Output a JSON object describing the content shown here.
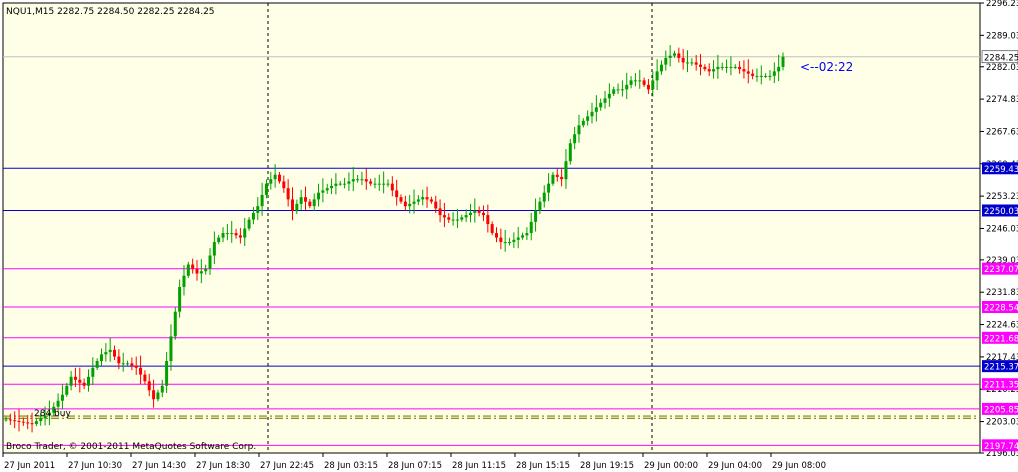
{
  "window": {
    "symbol_label": "NQU1,M15  2282.75 2284.50 2282.25 2284.25",
    "copyright": "Broco Trader, © 2001-2011 MetaQuotes Software Corp.",
    "timer_label": "<--02:22",
    "level_tag": "284 buy"
  },
  "colors": {
    "background": "#ffffe8",
    "bull_candle": "#00a000",
    "bear_candle": "#ff0000",
    "blue_level": "#0000cc",
    "magenta_level": "#ff00ff",
    "dash_dot_level": "#808000",
    "separator": "#000000",
    "grid_price_line": "#c0c0c0",
    "timer_text": "#0000ff"
  },
  "chart_data": {
    "type": "candlestick",
    "ylim": [
      2196.03,
      2296.23
    ],
    "y_ticks": [
      "2296.23",
      "2289.03",
      "2282.03",
      "2274.83",
      "2267.63",
      "2260.43",
      "2253.23",
      "2246.03",
      "2239.03",
      "2231.83",
      "2224.63",
      "2217.43",
      "2210.23",
      "2203.03",
      "2196.03"
    ],
    "x_ticks": [
      "27 Jun 2011",
      "27 Jun 10:30",
      "27 Jun 14:30",
      "27 Jun 18:30",
      "27 Jun 22:45",
      "28 Jun 03:15",
      "28 Jun 07:15",
      "28 Jun 11:15",
      "28 Jun 15:15",
      "28 Jun 19:15",
      "29 Jun 00:00",
      "29 Jun 04:00",
      "29 Jun 08:00"
    ],
    "day_separators": [
      "27 Jun 22:45",
      "29 Jun 00:00"
    ],
    "current_price": {
      "value": 2284.25,
      "label": "2284.25"
    },
    "levels": [
      {
        "value": 2259.43,
        "label": "2259.43",
        "color": "blue"
      },
      {
        "value": 2250.03,
        "label": "2250.03",
        "color": "blue"
      },
      {
        "value": 2237.07,
        "label": "2237.07",
        "color": "magenta"
      },
      {
        "value": 2228.54,
        "label": "2228.54",
        "color": "magenta"
      },
      {
        "value": 2221.68,
        "label": "2221.68",
        "color": "magenta"
      },
      {
        "value": 2215.37,
        "label": "2215.37",
        "color": "blue"
      },
      {
        "value": 2211.35,
        "label": "2211.35",
        "color": "magenta"
      },
      {
        "value": 2205.85,
        "label": "2205.85",
        "color": "magenta"
      },
      {
        "value": 2197.74,
        "label": "2197.74",
        "color": "magenta"
      }
    ],
    "dash_dot_levels": [
      2203.75,
      2204.25
    ],
    "price_path": [
      [
        0,
        2203.5
      ],
      [
        6,
        2202.5
      ],
      [
        10,
        2205
      ],
      [
        13,
        2209
      ],
      [
        15,
        2213
      ],
      [
        18,
        2211
      ],
      [
        20,
        2215
      ],
      [
        22,
        2218
      ],
      [
        24,
        2219
      ],
      [
        26,
        2216
      ],
      [
        28,
        2216
      ],
      [
        30,
        2215
      ],
      [
        32,
        2212
      ],
      [
        34,
        2208
      ],
      [
        36,
        2211
      ],
      [
        38,
        2222
      ],
      [
        40,
        2233
      ],
      [
        42,
        2238
      ],
      [
        44,
        2236
      ],
      [
        46,
        2237
      ],
      [
        48,
        2243
      ],
      [
        50,
        2245
      ],
      [
        52,
        2245
      ],
      [
        54,
        2244
      ],
      [
        56,
        2248
      ],
      [
        58,
        2251
      ],
      [
        60,
        2256
      ],
      [
        62,
        2258
      ],
      [
        64,
        2255
      ],
      [
        66,
        2250
      ],
      [
        68,
        2253
      ],
      [
        70,
        2251
      ],
      [
        72,
        2254
      ],
      [
        74,
        2255
      ],
      [
        76,
        2256
      ],
      [
        78,
        2256
      ],
      [
        80,
        2257
      ],
      [
        82,
        2257
      ],
      [
        84,
        2256
      ],
      [
        86,
        2256
      ],
      [
        88,
        2256
      ],
      [
        90,
        2253
      ],
      [
        92,
        2251
      ],
      [
        94,
        2252
      ],
      [
        96,
        2253
      ],
      [
        98,
        2252
      ],
      [
        100,
        2249
      ],
      [
        102,
        2248
      ],
      [
        104,
        2248
      ],
      [
        106,
        2249
      ],
      [
        108,
        2250
      ],
      [
        110,
        2249
      ],
      [
        112,
        2245
      ],
      [
        114,
        2243
      ],
      [
        116,
        2243
      ],
      [
        118,
        2244
      ],
      [
        120,
        2245
      ],
      [
        122,
        2250
      ],
      [
        124,
        2254
      ],
      [
        126,
        2258
      ],
      [
        128,
        2257
      ],
      [
        130,
        2265
      ],
      [
        132,
        2269
      ],
      [
        134,
        2271
      ],
      [
        136,
        2273
      ],
      [
        138,
        2275
      ],
      [
        140,
        2277
      ],
      [
        142,
        2277
      ],
      [
        144,
        2279
      ],
      [
        146,
        2279
      ],
      [
        148,
        2277
      ],
      [
        150,
        2281
      ],
      [
        152,
        2284
      ],
      [
        154,
        2285
      ],
      [
        156,
        2283
      ],
      [
        158,
        2283
      ],
      [
        160,
        2282
      ],
      [
        162,
        2281
      ],
      [
        164,
        2282
      ],
      [
        166,
        2282
      ],
      [
        168,
        2282
      ],
      [
        170,
        2281
      ],
      [
        172,
        2280
      ],
      [
        174,
        2280
      ],
      [
        176,
        2280
      ],
      [
        178,
        2282
      ],
      [
        179,
        2284.25
      ]
    ]
  }
}
